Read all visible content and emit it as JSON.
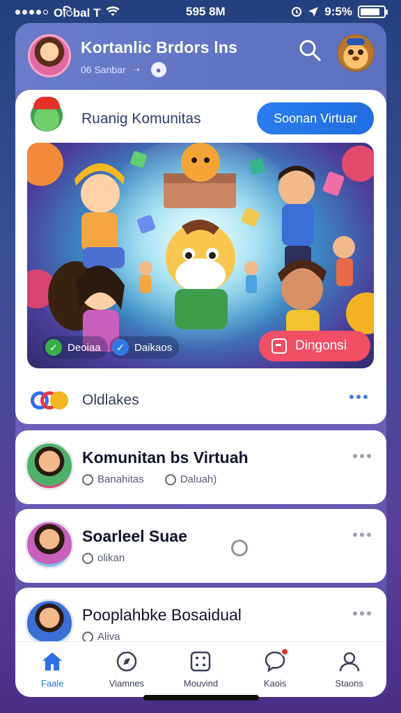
{
  "status_bar": {
    "carrier": "Oिbal T",
    "time": "595 8M",
    "right_text": "9:5%"
  },
  "header": {
    "title": "Kortanlic Brdors lns",
    "subtitle": "06 Sanbar"
  },
  "feature": {
    "title": "Ruanig Komunitas",
    "join_label": "Soonan Virtuar",
    "badge_1": "Deoiaa",
    "badge_2": "Daikaos",
    "cta_label": "Dingonsi",
    "footer_label": "Oldlakes"
  },
  "list": [
    {
      "title": "Komunitan bs Virtuah",
      "meta_1": "Banahitas",
      "meta_2": "Daluah)"
    },
    {
      "title": "Soarleel Suae",
      "meta_1": "olikan"
    },
    {
      "title": "Pooplahbke Bosaidual",
      "meta_1": "Aliva"
    }
  ],
  "nav": [
    {
      "label": "Faale",
      "icon": "home-icon",
      "active": true
    },
    {
      "label": "Viamnes",
      "icon": "compass-icon"
    },
    {
      "label": "Mouvind",
      "icon": "grid-icon"
    },
    {
      "label": "Kaois",
      "icon": "chat-icon"
    },
    {
      "label": "Staons",
      "icon": "profile-icon"
    }
  ],
  "colors": {
    "accent": "#2d6fe6",
    "cta": "#f04f66",
    "header": "#6a7cc9"
  }
}
